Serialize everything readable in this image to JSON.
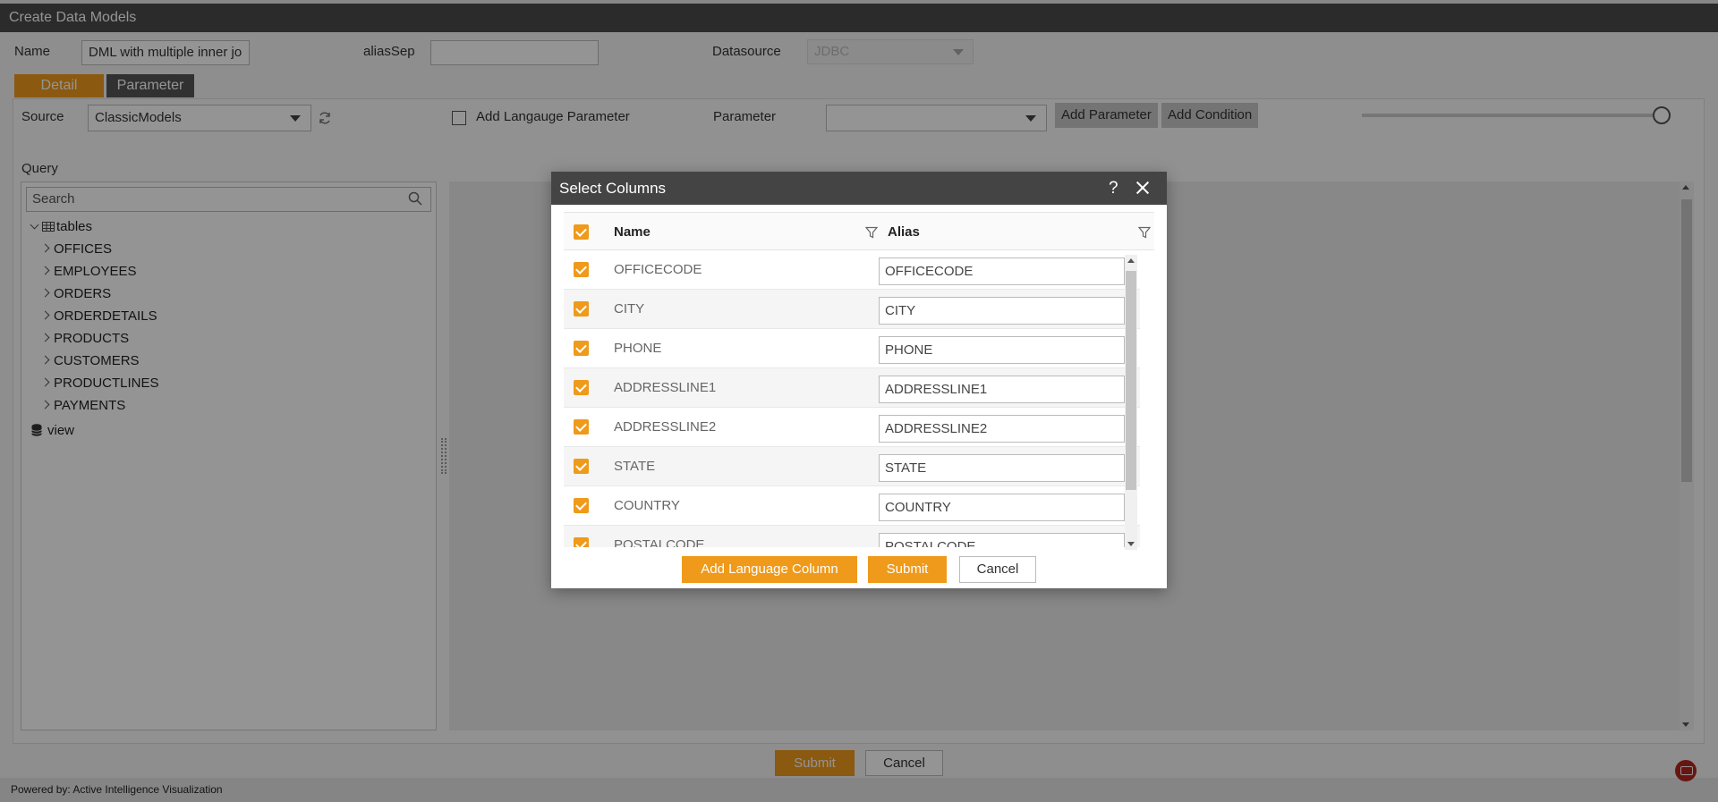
{
  "window": {
    "title": "Create Data Models"
  },
  "form": {
    "name_label": "Name",
    "name_value": "DML with multiple inner jo",
    "alias_sep_label": "aliasSep",
    "alias_sep_value": "",
    "datasource_label": "Datasource",
    "datasource_value": "JDBC"
  },
  "tabs": [
    {
      "label": "Detail",
      "active": true
    },
    {
      "label": "Parameter",
      "active": false
    }
  ],
  "toolbar": {
    "source_label": "Source",
    "source_value": "ClassicModels",
    "add_language_param_label": "Add Langauge Parameter",
    "parameter_label": "Parameter",
    "parameter_value": "",
    "add_parameter_label": "Add Parameter",
    "add_condition_label": "Add Condition"
  },
  "query": {
    "label": "Query",
    "search_placeholder": "Search",
    "tree": {
      "tables_label": "tables",
      "tables": [
        "OFFICES",
        "EMPLOYEES",
        "ORDERS",
        "ORDERDETAILS",
        "PRODUCTS",
        "CUSTOMERS",
        "PRODUCTLINES",
        "PAYMENTS"
      ],
      "view_label": "view"
    }
  },
  "page_actions": {
    "submit_label": "Submit",
    "cancel_label": "Cancel"
  },
  "footer": {
    "powered_by": "Powered by: Active Intelligence Visualization"
  },
  "dialog": {
    "title": "Select Columns",
    "help_glyph": "?",
    "columns": {
      "name_header": "Name",
      "alias_header": "Alias"
    },
    "rows": [
      {
        "name": "OFFICECODE",
        "alias": "OFFICECODE",
        "checked": true
      },
      {
        "name": "CITY",
        "alias": "CITY",
        "checked": true
      },
      {
        "name": "PHONE",
        "alias": "PHONE",
        "checked": true
      },
      {
        "name": "ADDRESSLINE1",
        "alias": "ADDRESSLINE1",
        "checked": true
      },
      {
        "name": "ADDRESSLINE2",
        "alias": "ADDRESSLINE2",
        "checked": true
      },
      {
        "name": "STATE",
        "alias": "STATE",
        "checked": true
      },
      {
        "name": "COUNTRY",
        "alias": "COUNTRY",
        "checked": true
      },
      {
        "name": "POSTALCODE",
        "alias": "POSTALCODE",
        "checked": true
      }
    ],
    "buttons": {
      "add_language_column_label": "Add Language Column",
      "submit_label": "Submit",
      "cancel_label": "Cancel"
    }
  },
  "colors": {
    "accent": "#ef9a1a",
    "titlebar": "#4a4a4a",
    "dialog_title": "#444444"
  }
}
